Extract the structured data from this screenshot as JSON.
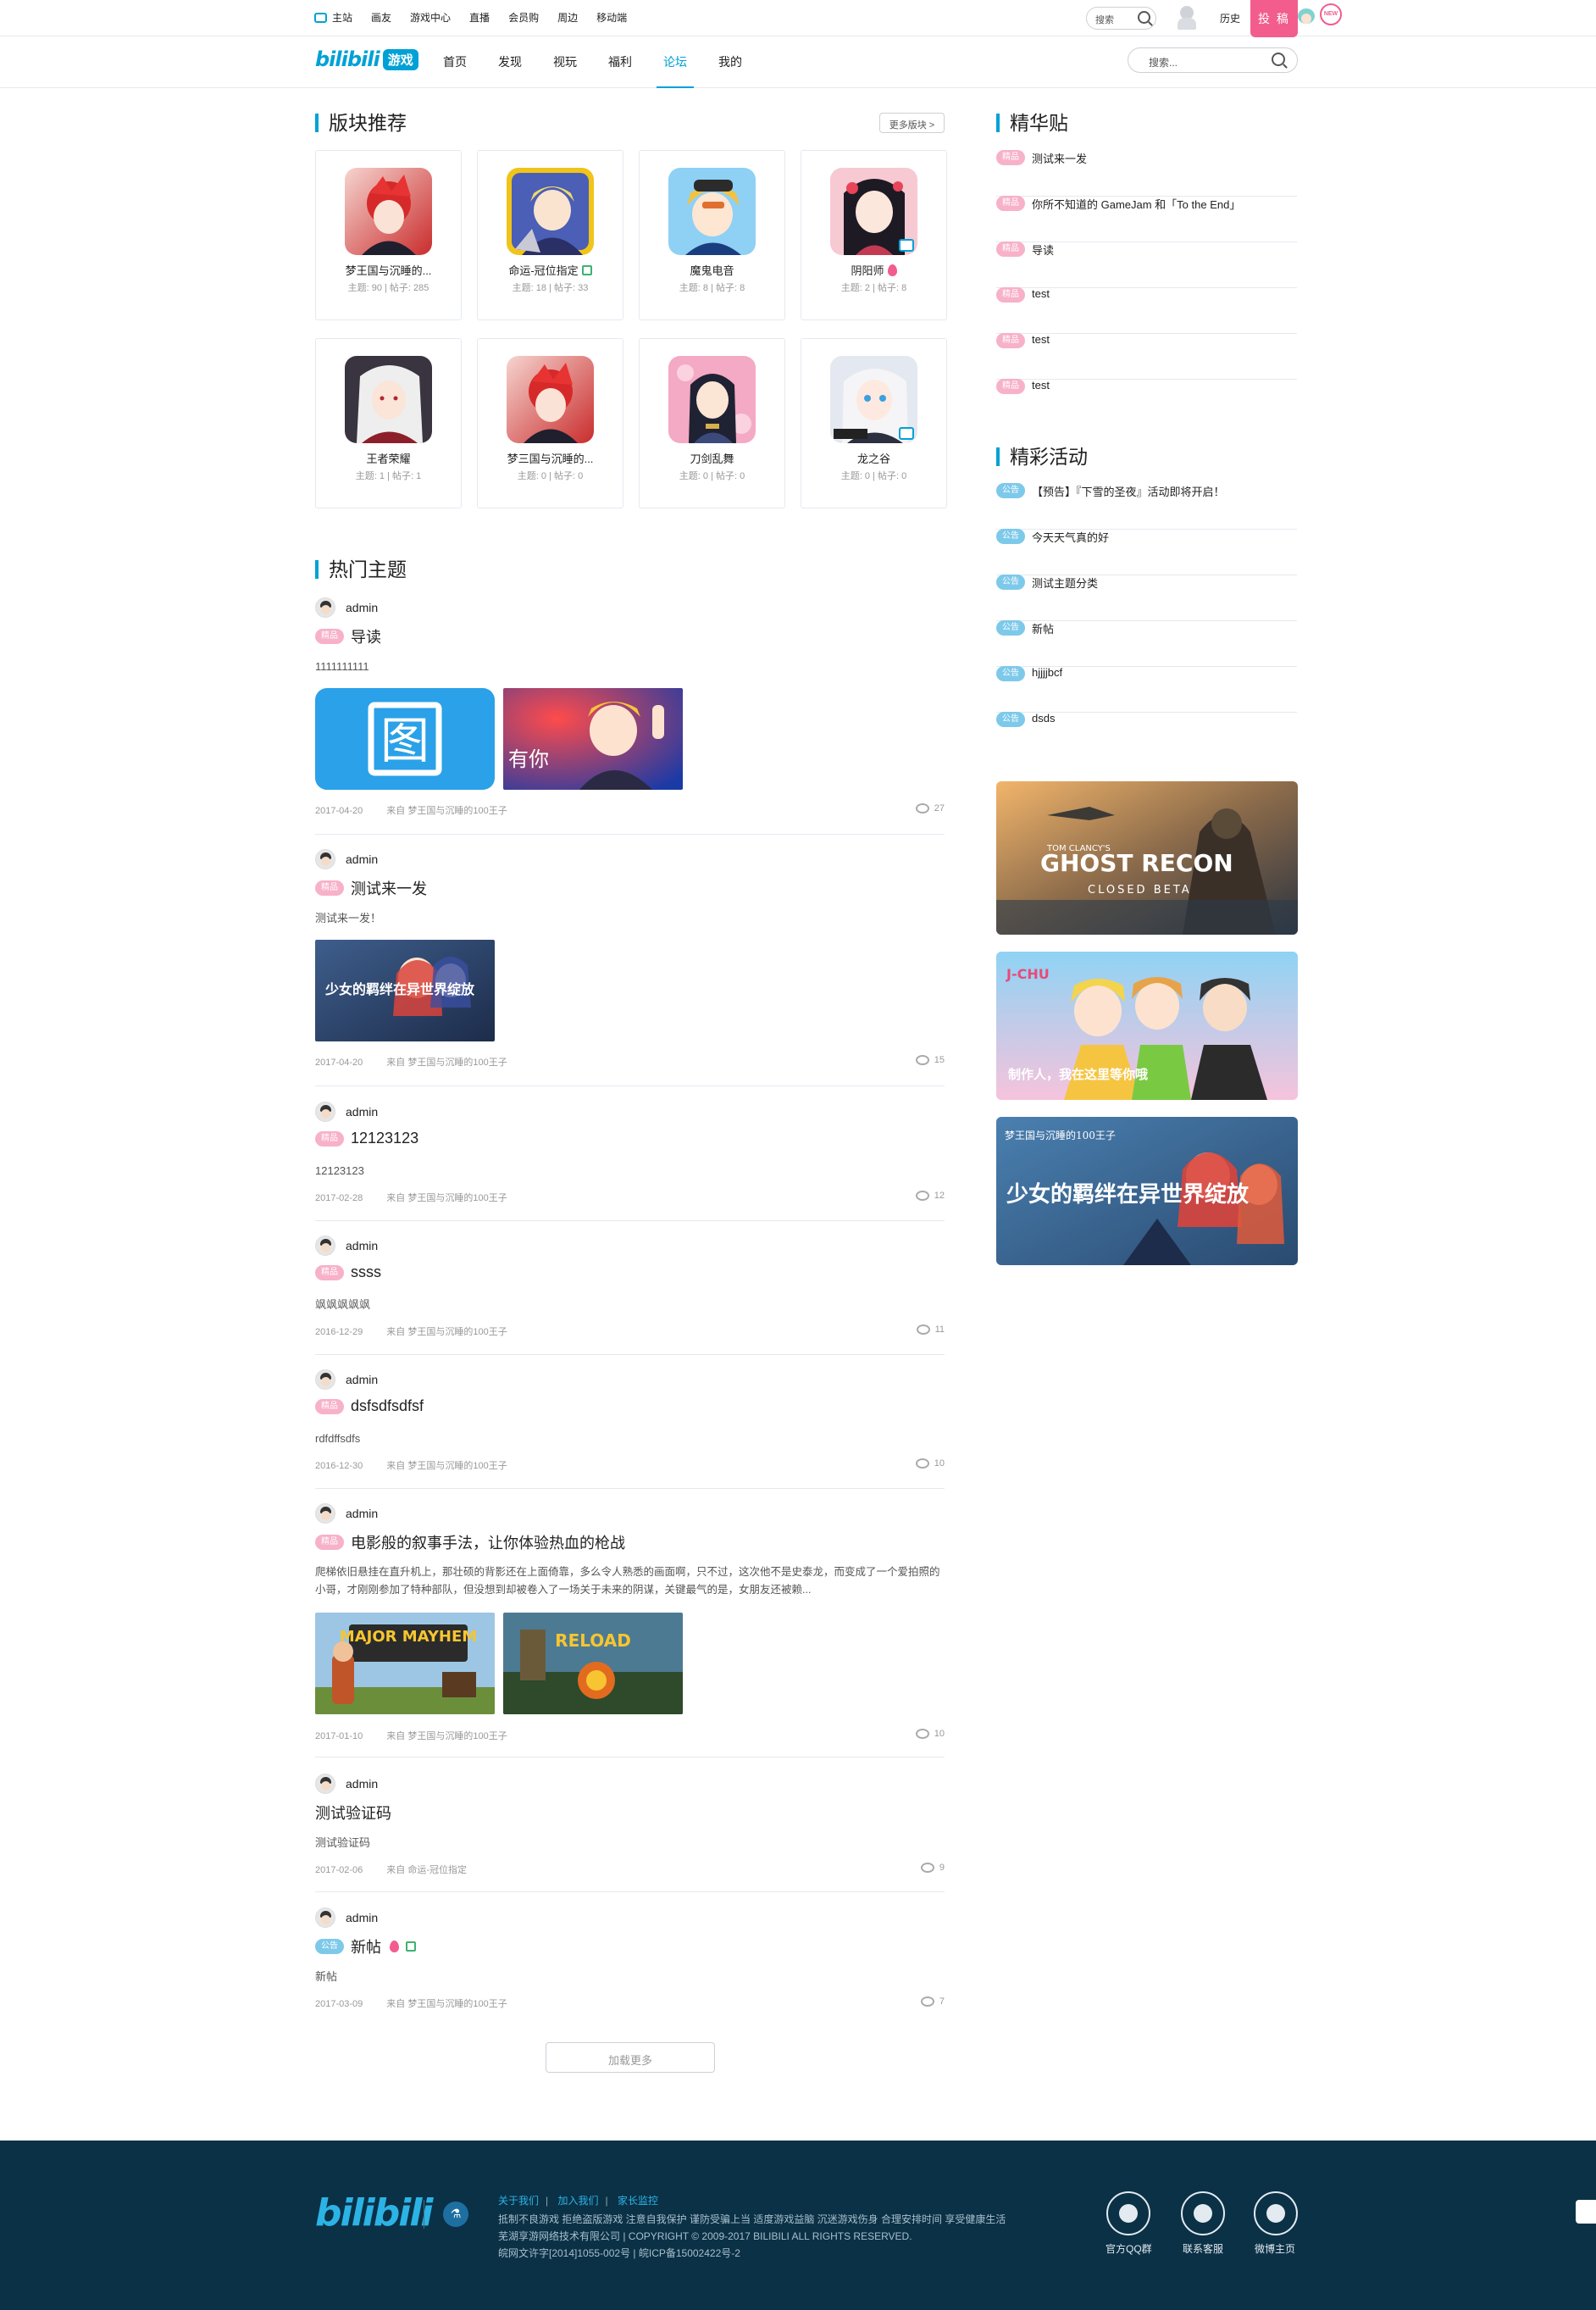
{
  "topbar": {
    "nav": [
      "主站",
      "画友",
      "游戏中心",
      "直播",
      "会员购",
      "周边",
      "移动端"
    ],
    "search_label": "搜索",
    "history": "历史",
    "upload": "投 稿",
    "new_badge": "NEW"
  },
  "header": {
    "logo_text": "bilibili",
    "logo_game": "游戏",
    "nav": [
      "首页",
      "发现",
      "视玩",
      "福利",
      "论坛",
      "我的"
    ],
    "active_nav": "论坛",
    "search_placeholder": "搜索..."
  },
  "boards": {
    "title": "版块推荐",
    "more": "更多版块 >",
    "items": [
      {
        "name": "梦王国与沉睡的...",
        "stats": "主题: 90 | 帖子: 285"
      },
      {
        "name": "命运-冠位指定",
        "stats": "主题: 18 | 帖子: 33",
        "flag": "good"
      },
      {
        "name": "魔鬼电音",
        "stats": "主题: 8 | 帖子: 8"
      },
      {
        "name": "阴阳师",
        "stats": "主题: 2 | 帖子: 8",
        "flag": "hot"
      },
      {
        "name": "王者荣耀",
        "stats": "主题: 1 | 帖子: 1"
      },
      {
        "name": "梦三国与沉睡的...",
        "stats": "主题: 0 | 帖子: 0"
      },
      {
        "name": "刀剑乱舞",
        "stats": "主题: 0 | 帖子: 0"
      },
      {
        "name": "龙之谷",
        "stats": "主题: 0 | 帖子: 0"
      }
    ]
  },
  "hot": {
    "title": "热门主题",
    "posts": [
      {
        "author": "admin",
        "tag": "精品",
        "title": "导读",
        "excerpt": "1111111111",
        "date": "2017-04-20",
        "source": "来自 梦王国与沉睡的100王子",
        "comments": "27",
        "images": [
          "图",
          "有你"
        ]
      },
      {
        "author": "admin",
        "tag": "精品",
        "title": "测试来一发",
        "excerpt": "测试来一发！",
        "date": "2017-04-20",
        "source": "来自 梦王国与沉睡的100王子",
        "comments": "15",
        "images": [
          "少女的羁绊在异世界绽放"
        ]
      },
      {
        "author": "admin",
        "tag": "精品",
        "title": "12123123",
        "excerpt": "12123123",
        "date": "2017-02-28",
        "source": "来自 梦王国与沉睡的100王子",
        "comments": "12"
      },
      {
        "author": "admin",
        "tag": "精品",
        "title": "ssss",
        "excerpt": "飒飒飒飒飒",
        "date": "2016-12-29",
        "source": "来自 梦王国与沉睡的100王子",
        "comments": "11"
      },
      {
        "author": "admin",
        "tag": "精品",
        "title": "dsfsdfsdfsf",
        "excerpt": "rdfdffsdfs",
        "date": "2016-12-30",
        "source": "来自 梦王国与沉睡的100王子",
        "comments": "10"
      },
      {
        "author": "admin",
        "tag": "精品",
        "title": "电影般的叙事手法，让你体验热血的枪战",
        "excerpt": "爬梯依旧悬挂在直升机上，那壮硕的背影还在上面倚靠，多么令人熟悉的画面啊，只不过，这次他不是史泰龙，而变成了一个爱拍照的小哥，才刚刚参加了特种部队，但没想到却被卷入了一场关于未来的阴谋，关键最气的是，女朋友还被赖...",
        "date": "2017-01-10",
        "source": "来自 梦王国与沉睡的100王子",
        "comments": "10",
        "images": [
          "MAJOR MAYHEM",
          "RELOAD"
        ]
      },
      {
        "author": "admin",
        "tag": "",
        "title": "测试验证码",
        "excerpt": "测试验证码",
        "date": "2017-02-06",
        "source": "来自 命运-冠位指定",
        "comments": "9"
      },
      {
        "author": "admin",
        "tag": "公告",
        "title": "新帖",
        "excerpt": "新帖",
        "date": "2017-03-09",
        "source": "来自 梦王国与沉睡的100王子",
        "comments": "7"
      }
    ],
    "load_more": "加载更多"
  },
  "digest": {
    "title": "精华贴",
    "tag": "精品",
    "items": [
      "测试来一发",
      "你所不知道的 GameJam 和「To the End」",
      "导读",
      "test",
      "test",
      "test"
    ]
  },
  "events": {
    "title": "精彩活动",
    "tag": "公告",
    "items": [
      "【预告】『下雪的圣夜』活动即将开启！",
      "今天天气真的好",
      "测试主题分类",
      "新帖",
      "hjjjjbcf",
      "dsds"
    ]
  },
  "banners": [
    {
      "headline": "GHOST RECON",
      "sub": "CLOSED BETA",
      "brand": "TOM CLANCY'S"
    },
    {
      "headline": "制作人，我在这里等你哦",
      "brand": "J-CHU"
    },
    {
      "headline": "少女的羁绊在异世界绽放",
      "brand": "梦王国与沉睡的100王子"
    }
  ],
  "footer": {
    "logo": "bilibili",
    "links": [
      "关于我们",
      "加入我们",
      "家长监控"
    ],
    "notice": "抵制不良游戏 拒绝盗版游戏 注意自我保护 谨防受骗上当 适度游戏益脑 沉迷游戏伤身 合理安排时间 享受健康生活",
    "copyright": "芜湖享游网络技术有限公司 | COPYRIGHT © 2009-2017 BILIBILI ALL RIGHTS RESERVED.",
    "icp": "皖网文许字[2014]1055-002号 | 皖ICP备15002422号-2",
    "icons": [
      "官方QQ群",
      "联系客服",
      "微博主页"
    ]
  }
}
